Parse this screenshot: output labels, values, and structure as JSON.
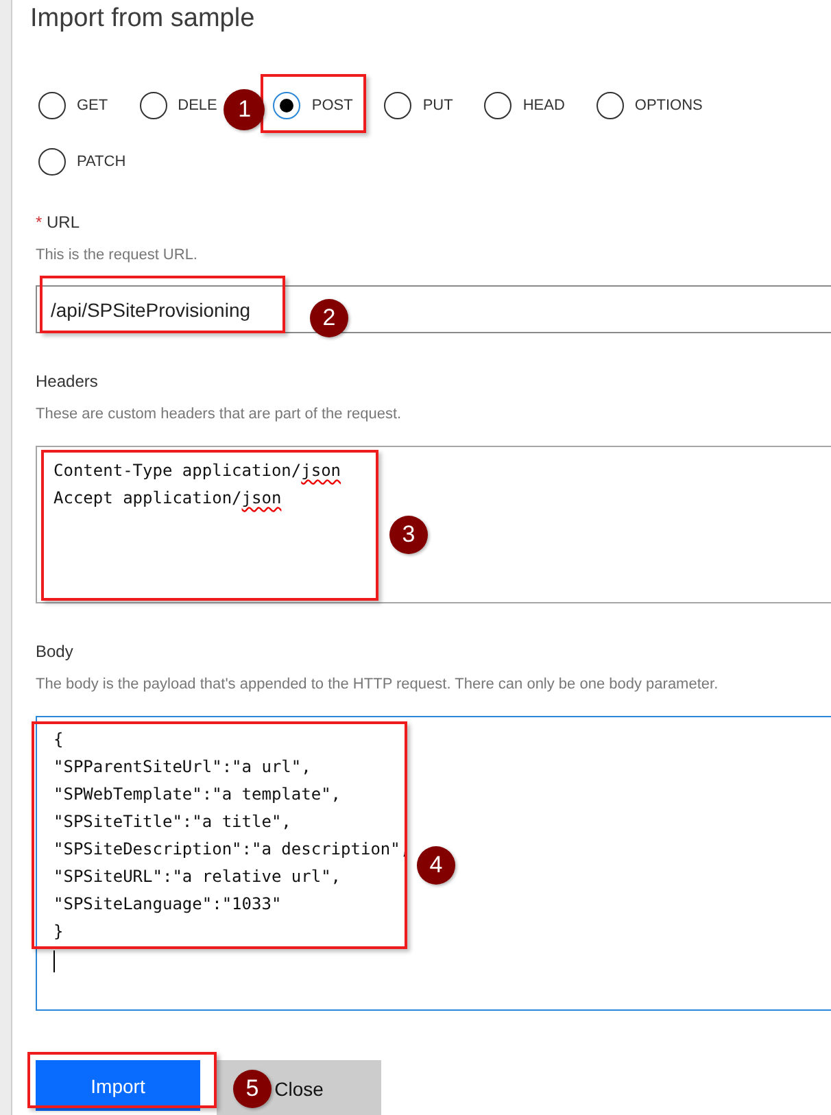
{
  "dialog": {
    "title": "Import from sample"
  },
  "methods": [
    {
      "label": "GET",
      "selected": false,
      "highlighted": false
    },
    {
      "label": "DELE",
      "selected": false,
      "highlighted": false
    },
    {
      "label": "POST",
      "selected": true,
      "highlighted": true,
      "annotation": "1"
    },
    {
      "label": "PUT",
      "selected": false,
      "highlighted": false
    },
    {
      "label": "HEAD",
      "selected": false,
      "highlighted": false
    },
    {
      "label": "OPTIONS",
      "selected": false,
      "highlighted": false
    },
    {
      "label": "PATCH",
      "selected": false,
      "highlighted": false
    }
  ],
  "url": {
    "required_mark": "*",
    "label": "URL",
    "description": "This is the request URL.",
    "value": "/api/SPSiteProvisioning",
    "focused": false,
    "highlighted": true,
    "annotation": "2"
  },
  "headers": {
    "label": "Headers",
    "description": "These are custom headers that are part of the request.",
    "focused": false,
    "highlighted": true,
    "annotation": "3",
    "lines": [
      {
        "segments": [
          {
            "text": "Content-Type application/",
            "misspelled": false
          },
          {
            "text": "json",
            "misspelled": true
          }
        ]
      },
      {
        "segments": [
          {
            "text": "Accept application/",
            "misspelled": false
          },
          {
            "text": "json",
            "misspelled": true
          }
        ]
      }
    ]
  },
  "body": {
    "label": "Body",
    "description": "The body is the payload that's appended to the HTTP request. There can only be one body parameter.",
    "focused": true,
    "highlighted": true,
    "annotation": "4",
    "lines": [
      {
        "segments": [
          {
            "text": "{",
            "misspelled": false
          }
        ]
      },
      {
        "segments": [
          {
            "text": "\"SPParentSiteUrl\":\"a url\",",
            "misspelled": false
          }
        ]
      },
      {
        "segments": [
          {
            "text": "\"SPWebTemplate\":\"a template\",",
            "misspelled": false
          }
        ]
      },
      {
        "segments": [
          {
            "text": "\"SPSiteTitle\":\"a title\",",
            "misspelled": false
          }
        ]
      },
      {
        "segments": [
          {
            "text": "\"SPSiteDescription\":\"a description\",",
            "misspelled": false
          }
        ]
      },
      {
        "segments": [
          {
            "text": "\"SPSiteURL\":\"a relative url\",",
            "misspelled": false
          }
        ]
      },
      {
        "segments": [
          {
            "text": "\"SPSiteLanguage\":\"1033\"",
            "misspelled": false
          }
        ]
      },
      {
        "segments": [
          {
            "text": "}",
            "misspelled": false
          }
        ]
      }
    ]
  },
  "buttons": [
    {
      "label": "Import",
      "kind": "primary",
      "highlighted": true,
      "annotation": "5"
    },
    {
      "label": "Close",
      "kind": "secondary",
      "highlighted": false
    }
  ]
}
